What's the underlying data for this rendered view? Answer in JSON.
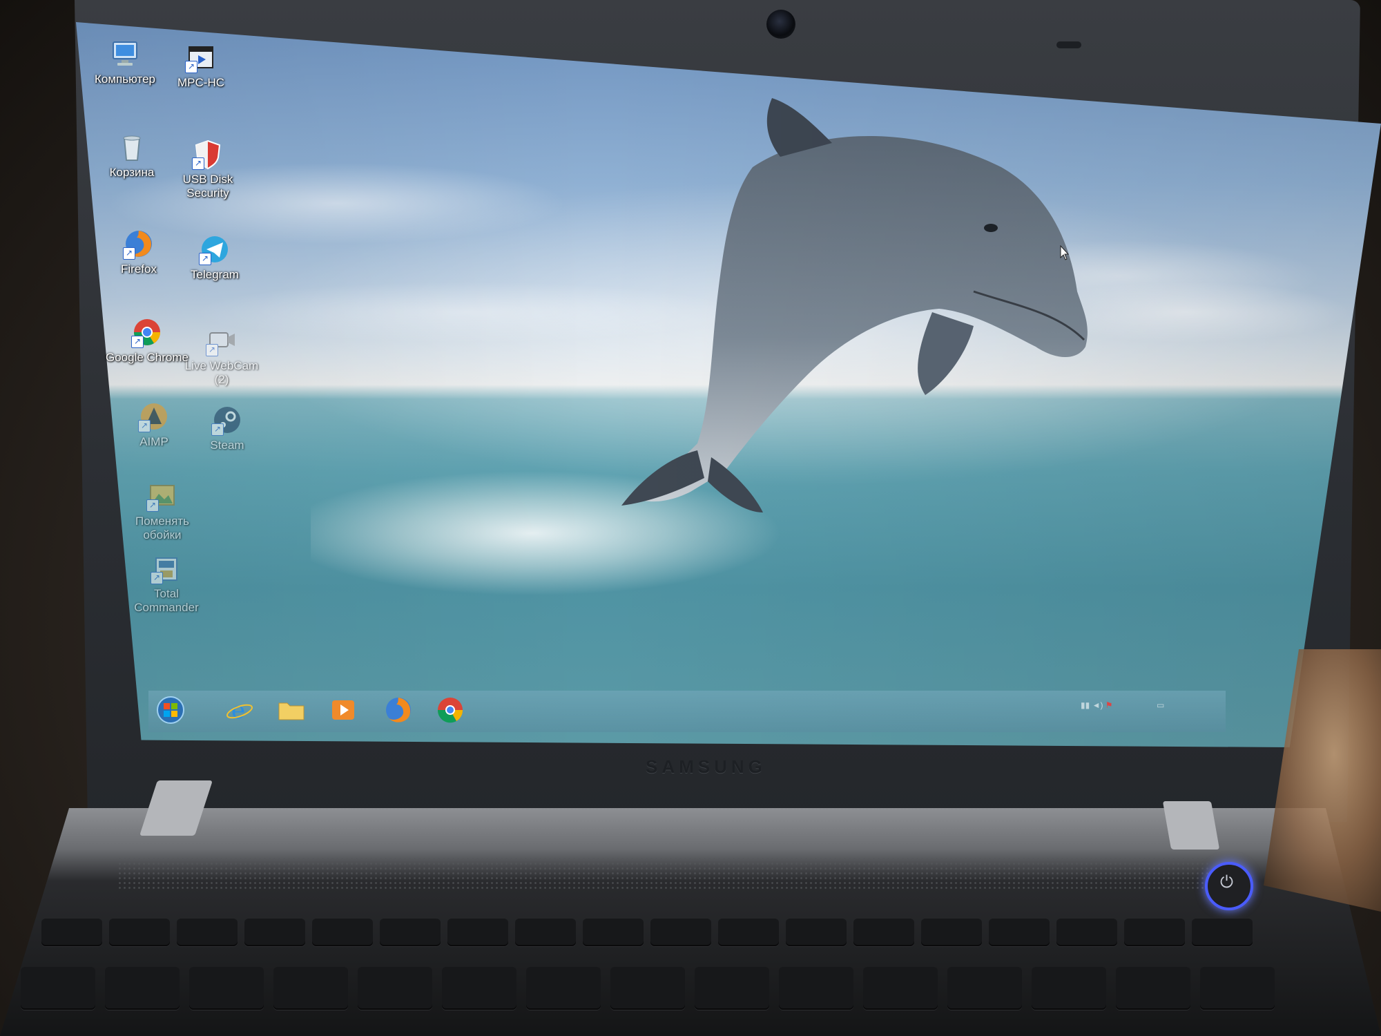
{
  "desktop": {
    "icons": [
      {
        "label": "Компьютер",
        "icon": "computer-icon"
      },
      {
        "label": "MPC-HC",
        "icon": "media-player-icon"
      },
      {
        "label": "Корзина",
        "icon": "recycle-bin-icon"
      },
      {
        "label": "USB Disk Security",
        "icon": "shield-icon"
      },
      {
        "label": "Firefox",
        "icon": "firefox-icon"
      },
      {
        "label": "Telegram",
        "icon": "telegram-icon"
      },
      {
        "label": "Google Chrome",
        "icon": "chrome-icon"
      },
      {
        "label": "Live WebCam (2)",
        "icon": "webcam-icon"
      },
      {
        "label": "AIMP",
        "icon": "aimp-icon"
      },
      {
        "label": "Steam",
        "icon": "steam-icon"
      },
      {
        "label": "Поменять обойки",
        "icon": "wallpaper-icon"
      },
      {
        "label": "Total Commander",
        "icon": "total-commander-icon"
      }
    ]
  },
  "taskbar": {
    "pinned": [
      {
        "name": "start-button",
        "icon": "windows-orb-icon"
      },
      {
        "name": "internet-explorer",
        "icon": "ie-icon"
      },
      {
        "name": "file-explorer",
        "icon": "folder-icon"
      },
      {
        "name": "media-player",
        "icon": "media-icon"
      },
      {
        "name": "firefox",
        "icon": "firefox-icon"
      },
      {
        "name": "chrome",
        "icon": "chrome-icon"
      }
    ]
  },
  "device": {
    "brand": "SAMSUNG"
  },
  "colors": {
    "sky": "#8fb0d3",
    "sea": "#5fa2b1",
    "dolphin": "#6c7c8c",
    "power_ring": "#4a5cff"
  }
}
